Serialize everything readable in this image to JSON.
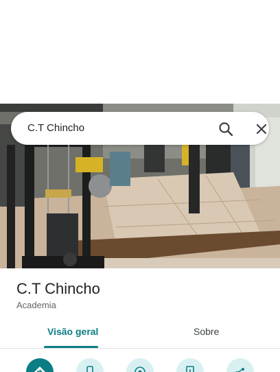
{
  "search": {
    "query": "C.T Chincho"
  },
  "place": {
    "name": "C.T Chincho",
    "category": "Academia"
  },
  "tabs": [
    {
      "label": "Visão geral",
      "active": true
    },
    {
      "label": "Sobre",
      "active": false
    }
  ],
  "actions": [
    {
      "icon": "directions-icon"
    },
    {
      "icon": "phone-icon"
    },
    {
      "icon": "website-icon"
    },
    {
      "icon": "save-icon"
    },
    {
      "icon": "share-icon"
    }
  ],
  "colors": {
    "accent": "#0b7d84",
    "action_bg": "#d9f0f2",
    "text": "#202124",
    "secondary_text": "#5f6368"
  }
}
